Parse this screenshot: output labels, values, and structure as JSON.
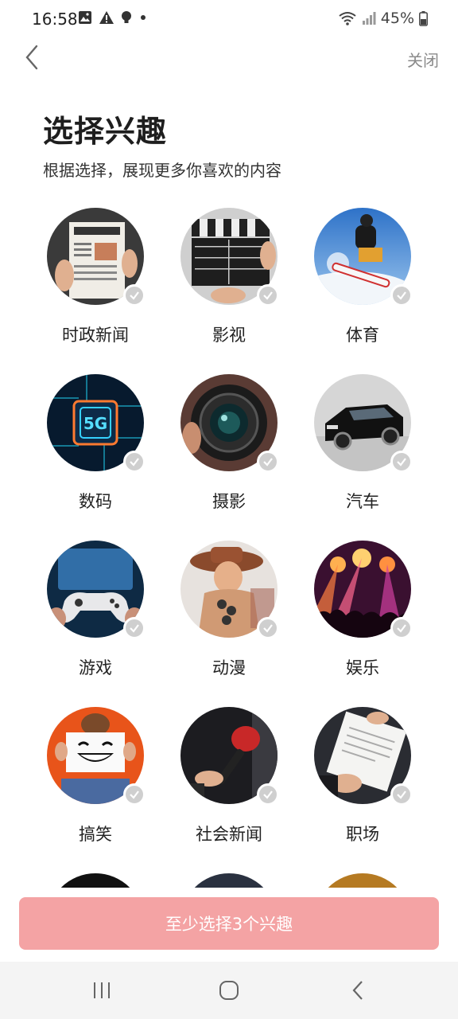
{
  "status_bar": {
    "time": "16:58",
    "battery": "45%",
    "icons": [
      "gallery-icon",
      "warning-icon",
      "bulb-icon",
      "dot-icon",
      "wifi-icon",
      "signal-icon",
      "battery-icon"
    ]
  },
  "nav": {
    "close_label": "关闭"
  },
  "header": {
    "title": "选择兴趣",
    "subtitle": "根据选择，展现更多你喜欢的内容"
  },
  "interests": [
    {
      "label": "时政新闻",
      "icon": "newspaper-image",
      "selected": false
    },
    {
      "label": "影视",
      "icon": "clapperboard-image",
      "selected": false
    },
    {
      "label": "体育",
      "icon": "snowboard-image",
      "selected": false
    },
    {
      "label": "数码",
      "icon": "chip-5g-image",
      "selected": false
    },
    {
      "label": "摄影",
      "icon": "camera-lens-image",
      "selected": false
    },
    {
      "label": "汽车",
      "icon": "car-image",
      "selected": false
    },
    {
      "label": "游戏",
      "icon": "gamepad-image",
      "selected": false
    },
    {
      "label": "动漫",
      "icon": "anime-figure-image",
      "selected": false
    },
    {
      "label": "娱乐",
      "icon": "concert-image",
      "selected": false
    },
    {
      "label": "搞笑",
      "icon": "smiley-sign-image",
      "selected": false
    },
    {
      "label": "社会新闻",
      "icon": "microphone-image",
      "selected": false
    },
    {
      "label": "职场",
      "icon": "contract-image",
      "selected": false
    }
  ],
  "cta": {
    "label": "至少选择3个兴趣"
  },
  "colors": {
    "cta_background": "#f4a3a4",
    "check_badge": "#cfcfcf",
    "nav_bar": "#f4f4f4"
  }
}
